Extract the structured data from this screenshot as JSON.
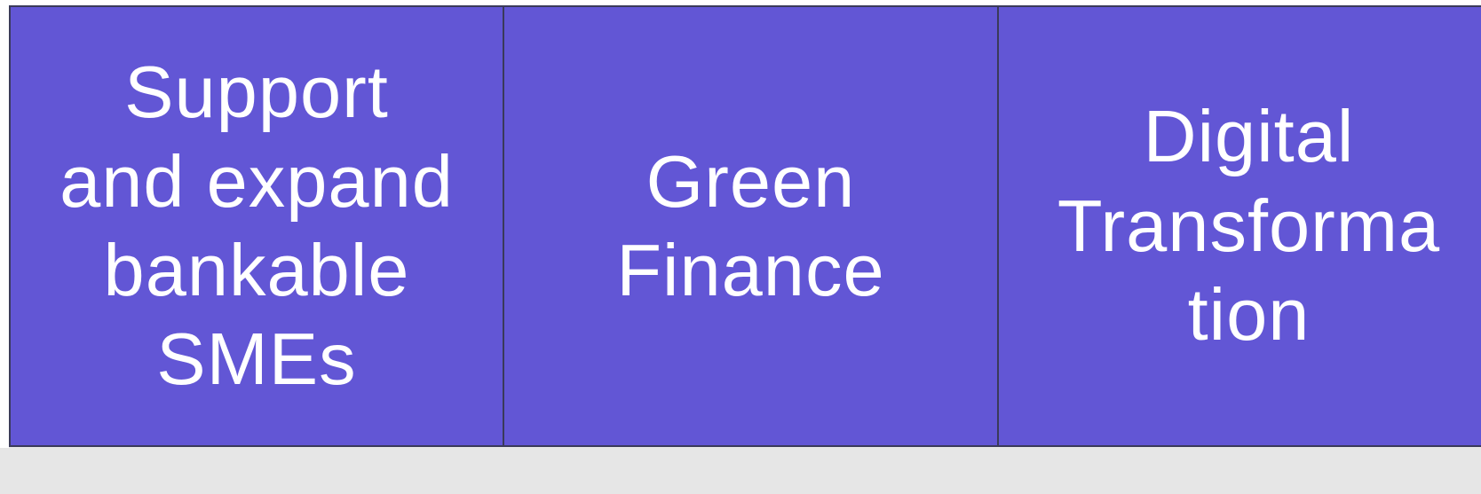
{
  "boxes": [
    {
      "text": "Support\nand expand\nbankable\nSMEs"
    },
    {
      "text": "Green\nFinance"
    },
    {
      "text": "Digital\nTransforma\ntion"
    }
  ],
  "colors": {
    "box_fill": "#6256d5",
    "box_border": "#3a3a5a",
    "text": "#ffffff",
    "background": "#e6e6e6"
  }
}
